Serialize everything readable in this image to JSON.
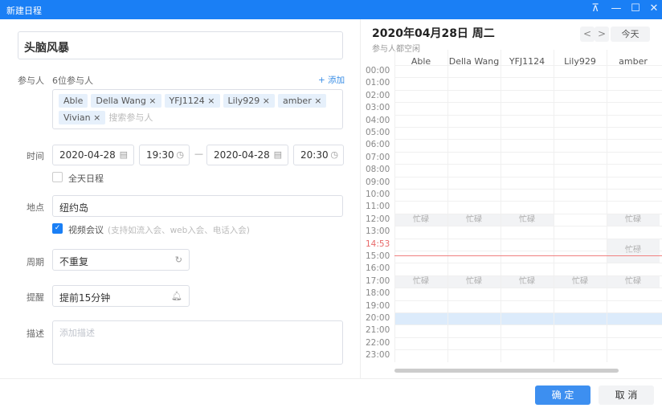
{
  "window": {
    "title": "新建日程",
    "controls": [
      "pin",
      "minimize",
      "maximize",
      "close"
    ]
  },
  "colors": {
    "accent": "#1a7ff5",
    "now_line": "#f08080",
    "busy": "#f2f3f5",
    "selected": "#dcebfb"
  },
  "form": {
    "title_value": "头脑风暴",
    "participants": {
      "label": "参与人",
      "count_text": "6位参与人",
      "add_label": "+ 添加",
      "search_placeholder": "搜索参与人",
      "tags": [
        {
          "name": "Able",
          "removable": false
        },
        {
          "name": "Della Wang ×",
          "removable": true
        },
        {
          "name": "YFJ1124 ×",
          "removable": true
        },
        {
          "name": "Lily929 ×",
          "removable": true
        },
        {
          "name": "amber ×",
          "removable": true
        },
        {
          "name": "Vivian ×",
          "removable": true
        }
      ]
    },
    "time": {
      "label": "时间",
      "start_date": "2020-04-28",
      "start_time": "19:30",
      "separator": "—",
      "end_date": "2020-04-28",
      "end_time": "20:30",
      "all_day_label": "全天日程",
      "all_day": false
    },
    "location": {
      "label": "地点",
      "value": "纽约岛",
      "video_label": "视频会议",
      "video_hint": "(支持如流入会、web入会、电话入会)",
      "video_checked": true
    },
    "repeat": {
      "label": "周期",
      "value": "不重复"
    },
    "reminder": {
      "label": "提醒",
      "value": "提前15分钟"
    },
    "description": {
      "label": "描述",
      "placeholder": "添加描述"
    }
  },
  "calendar": {
    "date_title": "2020年04月28日 周二",
    "subtitle": "参与人都空闲",
    "prev": "<",
    "next": ">",
    "today": "今天",
    "columns": [
      "Able",
      "Della Wang",
      "YFJ1124",
      "Lily929",
      "amber"
    ],
    "hours": [
      "00:00",
      "01:00",
      "02:00",
      "03:00",
      "04:00",
      "05:00",
      "06:00",
      "07:00",
      "08:00",
      "09:00",
      "10:00",
      "11:00",
      "12:00",
      "13:00",
      "14:53",
      "15:00",
      "16:00",
      "17:00",
      "18:00",
      "19:00",
      "20:00",
      "21:00",
      "22:00",
      "23:00"
    ],
    "now_time": "14:53",
    "busy_label": "忙碌",
    "busy": [
      {
        "col": 0,
        "start": 12,
        "end": 13
      },
      {
        "col": 1,
        "start": 12,
        "end": 13
      },
      {
        "col": 2,
        "start": 12,
        "end": 13
      },
      {
        "col": 4,
        "start": 12,
        "end": 13
      },
      {
        "col": 4,
        "start": 14,
        "end": 16
      },
      {
        "col": 0,
        "start": 17,
        "end": 18
      },
      {
        "col": 1,
        "start": 17,
        "end": 18
      },
      {
        "col": 2,
        "start": 17,
        "end": 18
      },
      {
        "col": 3,
        "start": 17,
        "end": 18
      },
      {
        "col": 4,
        "start": 17,
        "end": 18
      }
    ],
    "selected": {
      "start": 20,
      "end": 21
    }
  },
  "footer": {
    "confirm": "确 定",
    "cancel": "取 消"
  }
}
